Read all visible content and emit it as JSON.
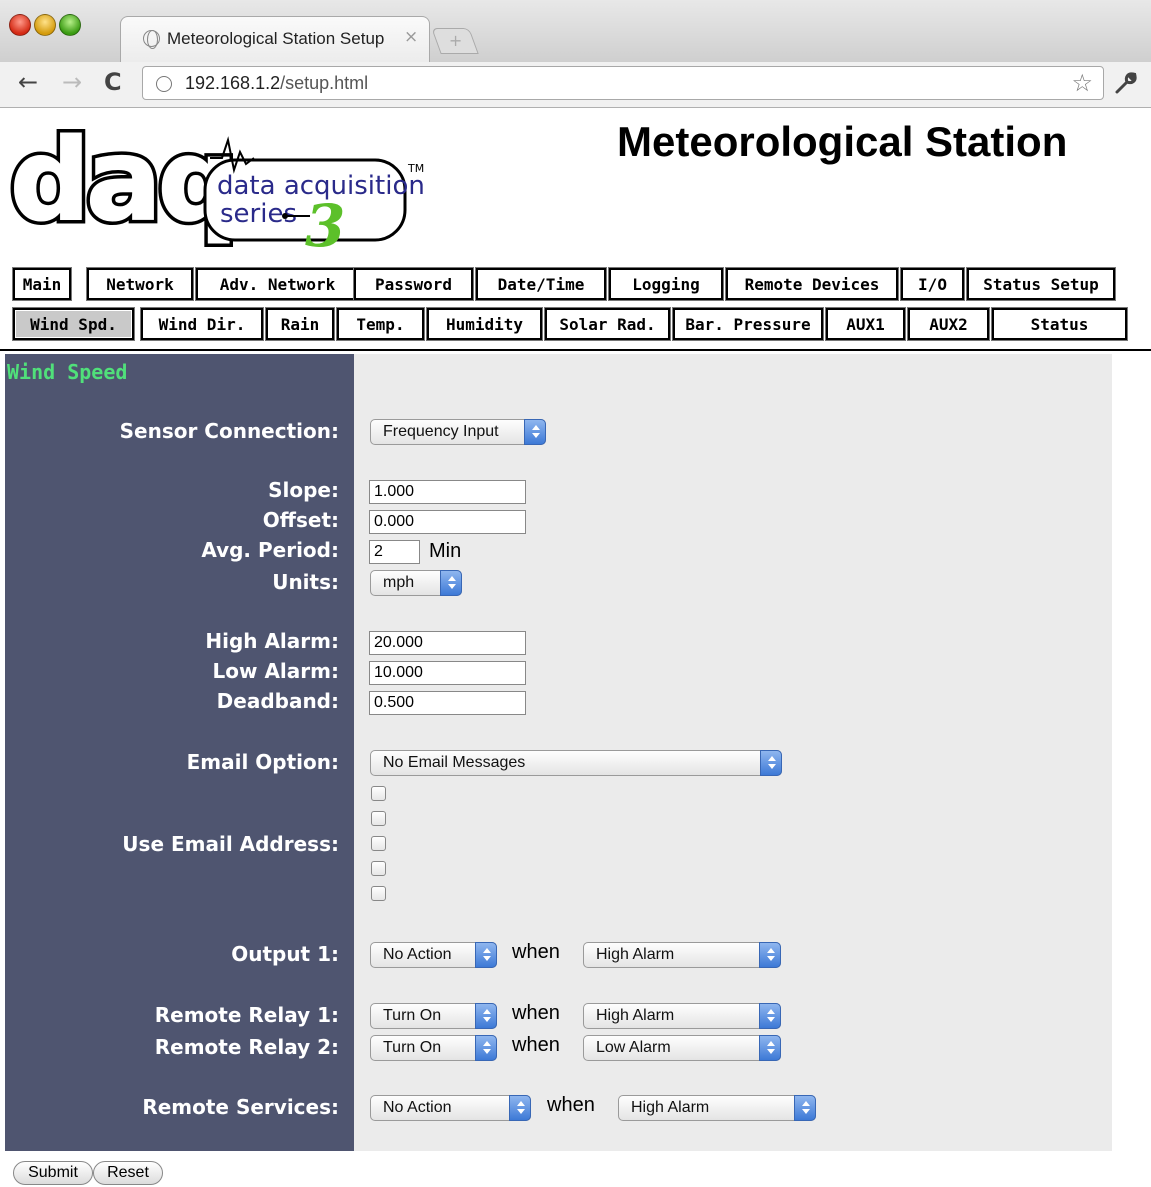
{
  "browser": {
    "tab_title": "Meteorological Station Setup",
    "tab_close": "×",
    "new_tab": "+",
    "back": "←",
    "forward": "→",
    "reload": "C",
    "url_host": "192.168.1.2",
    "url_path": "/setup.html",
    "star": "☆",
    "wrench": "🔧"
  },
  "header": {
    "title": "Meteorological Station",
    "logo": {
      "brand": "daq",
      "line1": "data acquisition",
      "line2": "series",
      "number": "3",
      "tm": "TM"
    }
  },
  "tabs_row1": [
    "Main",
    "Network",
    "Adv. Network",
    "Password",
    "Date/Time",
    "Logging",
    "Remote Devices",
    "I/O",
    "Status Setup"
  ],
  "tabs_row2": [
    "Wind Spd.",
    "Wind Dir.",
    "Rain",
    "Temp.",
    "Humidity",
    "Solar Rad.",
    "Bar. Pressure",
    "AUX1",
    "AUX2",
    "Status"
  ],
  "active_tab": "Wind Spd.",
  "form": {
    "section_title": "Wind Speed",
    "sensor_connection": {
      "label": "Sensor Connection:",
      "value": "Frequency Input"
    },
    "slope": {
      "label": "Slope:",
      "value": "1.000"
    },
    "offset": {
      "label": "Offset:",
      "value": "0.000"
    },
    "avg_period": {
      "label": "Avg. Period:",
      "value": "2",
      "unit": "Min"
    },
    "units": {
      "label": "Units:",
      "value": "mph"
    },
    "high_alarm": {
      "label": "High Alarm:",
      "value": "20.000"
    },
    "low_alarm": {
      "label": "Low Alarm:",
      "value": "10.000"
    },
    "deadband": {
      "label": "Deadband:",
      "value": "0.500"
    },
    "email_option": {
      "label": "Email Option:",
      "value": "No Email Messages"
    },
    "use_email_address": {
      "label": "Use Email Address:",
      "checked": [
        false,
        false,
        false,
        false,
        false
      ]
    },
    "when": "when",
    "output1": {
      "label": "Output 1:",
      "action": "No Action",
      "condition": "High Alarm"
    },
    "remote_relay1": {
      "label": "Remote Relay 1:",
      "action": "Turn On",
      "condition": "High Alarm"
    },
    "remote_relay2": {
      "label": "Remote Relay 2:",
      "action": "Turn On",
      "condition": "Low Alarm"
    },
    "remote_services": {
      "label": "Remote Services:",
      "action": "No Action",
      "condition": "High Alarm"
    }
  },
  "buttons": {
    "submit": "Submit",
    "reset": "Reset"
  },
  "colors": {
    "label_panel": "#4f5570",
    "input_panel": "#ebebeb",
    "section_title": "#50e07a"
  }
}
